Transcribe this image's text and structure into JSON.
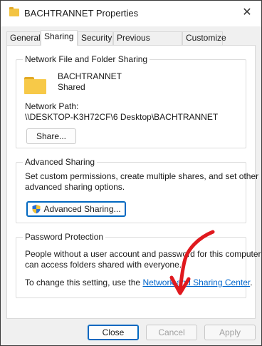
{
  "window": {
    "title": "BACHTRANNET Properties"
  },
  "tabs": [
    {
      "label": "General"
    },
    {
      "label": "Sharing"
    },
    {
      "label": "Security"
    },
    {
      "label": "Previous Versions"
    },
    {
      "label": "Customize"
    }
  ],
  "network_sharing": {
    "group_title": "Network File and Folder Sharing",
    "folder_name": "BACHTRANNET",
    "status": "Shared",
    "path_label": "Network Path:",
    "path_value": "\\\\DESKTOP-K3H72CF\\6 Desktop\\BACHTRANNET",
    "share_button": "Share..."
  },
  "advanced_sharing": {
    "group_title": "Advanced Sharing",
    "description_line1": "Set custom permissions, create multiple shares, and set other",
    "description_line2": "advanced sharing options.",
    "button": "Advanced Sharing..."
  },
  "password_protection": {
    "group_title": "Password Protection",
    "description_line1": "People without a user account and password for this computer",
    "description_line2": "can access folders shared with everyone.",
    "change_prefix": "To change this setting, use the ",
    "link": "Network and Sharing Center",
    "change_suffix": "."
  },
  "footer": {
    "close": "Close",
    "cancel": "Cancel",
    "apply": "Apply"
  },
  "annotation": {
    "arrow_color": "#e0191e"
  },
  "icons": [
    "folder-icon",
    "close-icon",
    "shield-icon"
  ]
}
